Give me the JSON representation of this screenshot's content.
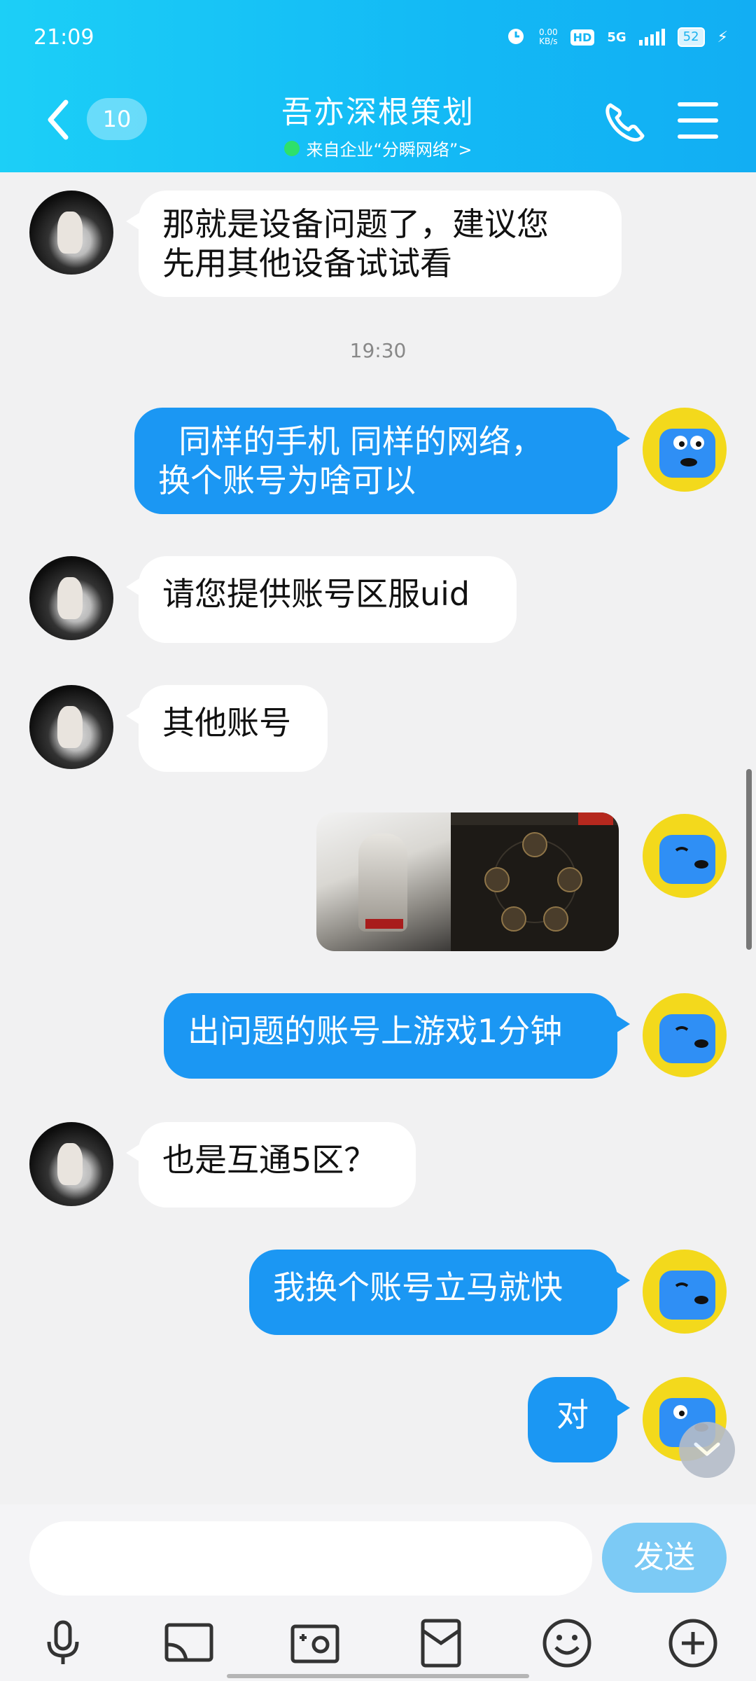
{
  "status_bar": {
    "time": "21:09",
    "net_speed_value": "0.00",
    "net_speed_unit": "KB/s",
    "hd": "HD",
    "network": "5G",
    "battery": "52"
  },
  "header": {
    "unread_count": "10",
    "title": "吾亦深根策划",
    "subtitle": "来自企业“分瞬网络”>"
  },
  "messages": [
    {
      "from": "them",
      "text": "那就是设备问题了，建议您\n先用其他设备试试看"
    },
    {
      "from": "divider",
      "text": "19:30"
    },
    {
      "from": "me",
      "text": "  同样的手机 同样的网络，\n换个账号为啥可以"
    },
    {
      "from": "them",
      "text": "请您提供账号区服uid"
    },
    {
      "from": "them",
      "text": "其他账号"
    },
    {
      "from": "me",
      "type": "image"
    },
    {
      "from": "me",
      "text": "出问题的账号上游戏1分钟"
    },
    {
      "from": "them",
      "text": "也是互通5区？"
    },
    {
      "from": "me",
      "text": "我换个账号立马就快"
    },
    {
      "from": "me",
      "text": "对"
    }
  ],
  "input": {
    "placeholder": "",
    "send_label": "发送"
  },
  "toolbar": [
    "microphone-icon",
    "cast-icon",
    "photo-icon",
    "gift-icon",
    "emoji-icon",
    "plus-icon"
  ],
  "colors": {
    "header_gradient_start": "#1ccff7",
    "header_gradient_end": "#12aef3",
    "my_bubble": "#1b97f3",
    "their_bubble": "#ffffff",
    "send_button": "#7ccaf5",
    "online_dot": "#2ee06a"
  }
}
